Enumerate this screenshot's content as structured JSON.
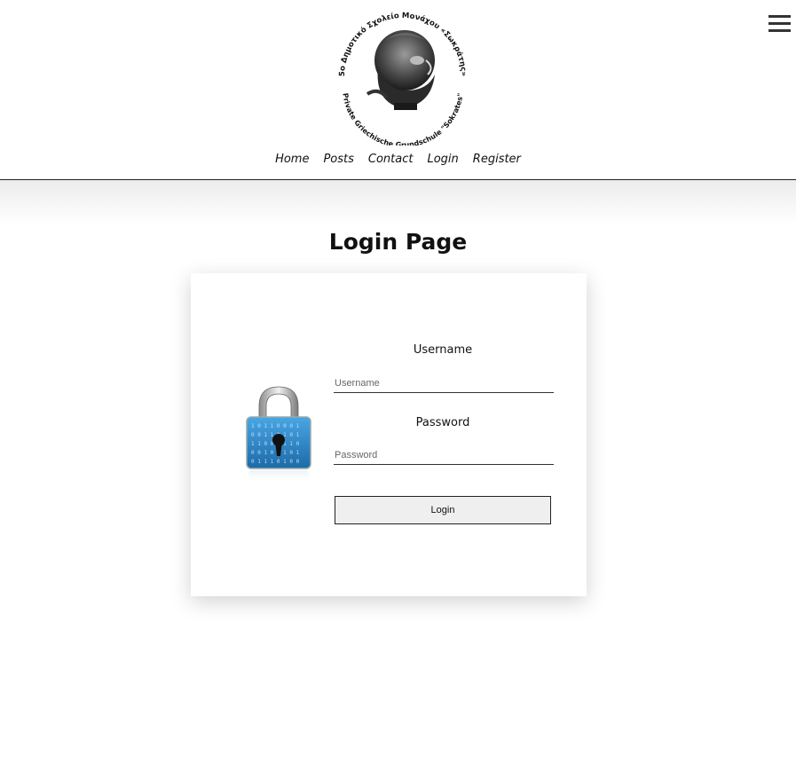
{
  "header": {
    "logo": {
      "top_text": "5o Δημοτικό Σχολείο Μονάχου «Σωκράτης»",
      "bottom_text": "Private Griechische Grundschule \"Sokrates\""
    },
    "nav": [
      {
        "label": "Home"
      },
      {
        "label": "Posts"
      },
      {
        "label": "Contact"
      },
      {
        "label": "Login"
      },
      {
        "label": "Register"
      }
    ]
  },
  "main": {
    "title": "Login Page",
    "form": {
      "username_label": "Username",
      "username_placeholder": "Username",
      "username_value": "",
      "password_label": "Password",
      "password_placeholder": "Password",
      "password_value": "",
      "submit_label": "Login"
    }
  },
  "icons": {
    "menu": "hamburger-menu-icon",
    "lock": "padlock-icon"
  },
  "colors": {
    "text": "#111111",
    "button_bg": "#efefef",
    "lock_blue": "#2f86c9"
  }
}
